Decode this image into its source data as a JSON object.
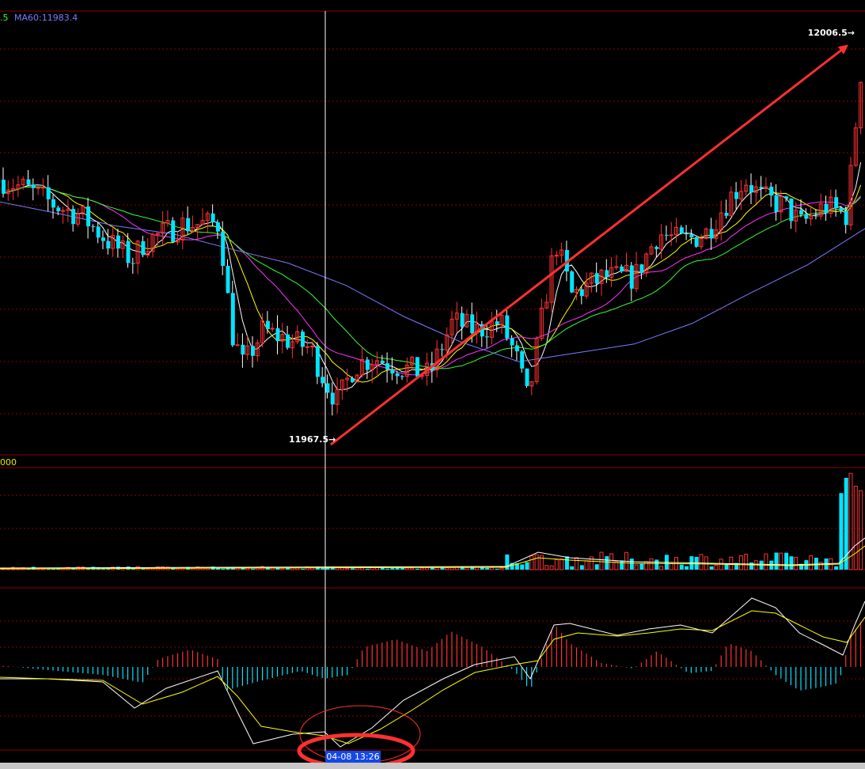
{
  "ma_legend": {
    "partial": ".5",
    "ma60_label": "MA60:11983.4",
    "partial_color": "#33ff33",
    "ma60_color": "#7a7aff"
  },
  "volume_scale_text": "000",
  "crosshair_date": "04-08 13:26",
  "chart_data": {
    "type": "candlestick",
    "annotations": {
      "high_label": "12006.5→",
      "low_label": "11967.5→",
      "trend_arrow": "low-to-high red arrow",
      "circled_region": "MACD bottom near crosshair"
    },
    "price_range": [
      11962,
      12012
    ],
    "colors": {
      "up": "#ff3232",
      "down": "#00e5ff",
      "ma5": "#ffffff",
      "ma10": "#ffff00",
      "ma20": "#ff33ff",
      "ma30": "#33ff33",
      "ma60": "#7a7aff",
      "grid": "#8b0000"
    },
    "ma60": [
      11990.5,
      11989.2,
      11987.8,
      11986.9,
      11985.2,
      11983.6,
      11981.1,
      11977.6,
      11974.7,
      11972.5,
      11973.5,
      11974.5,
      11976.8,
      11980.2,
      11983.4,
      11987.5
    ]
  }
}
